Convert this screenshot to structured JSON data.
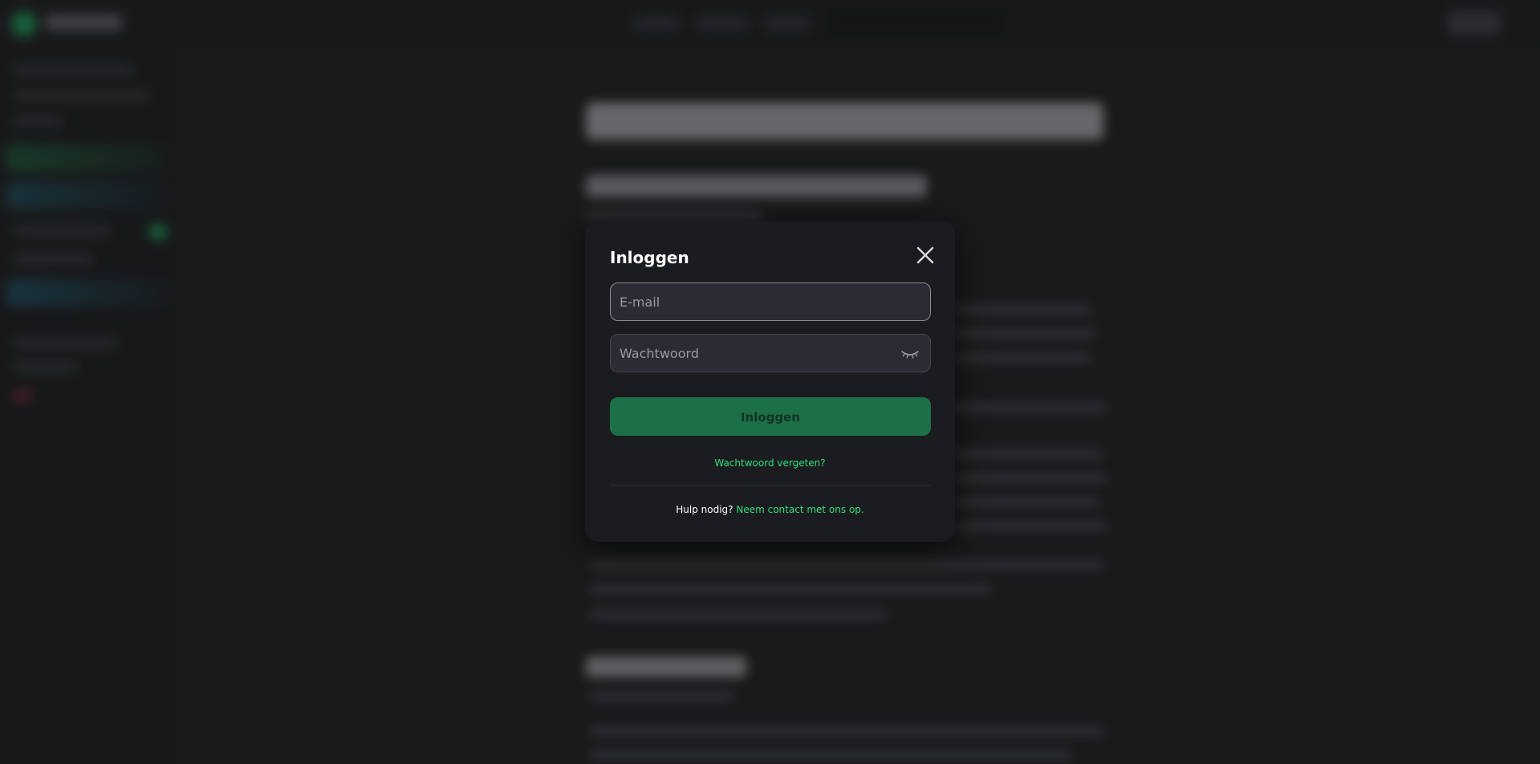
{
  "modal": {
    "title": "Inloggen",
    "email_placeholder": "E-mail",
    "password_placeholder": "Wachtwoord",
    "login_button": "Inloggen",
    "forgot_password": "Wachtwoord vergeten?",
    "help_text": "Hulp nodig?",
    "help_link": "Neem contact met ons op."
  },
  "colors": {
    "accent_green": "#2ee07c",
    "button_green": "#1c7048",
    "modal_background": "#1b1c1f",
    "input_background": "#2a2b33"
  },
  "icons": {
    "close": "close-icon",
    "password_toggle": "eye-closed-icon"
  }
}
